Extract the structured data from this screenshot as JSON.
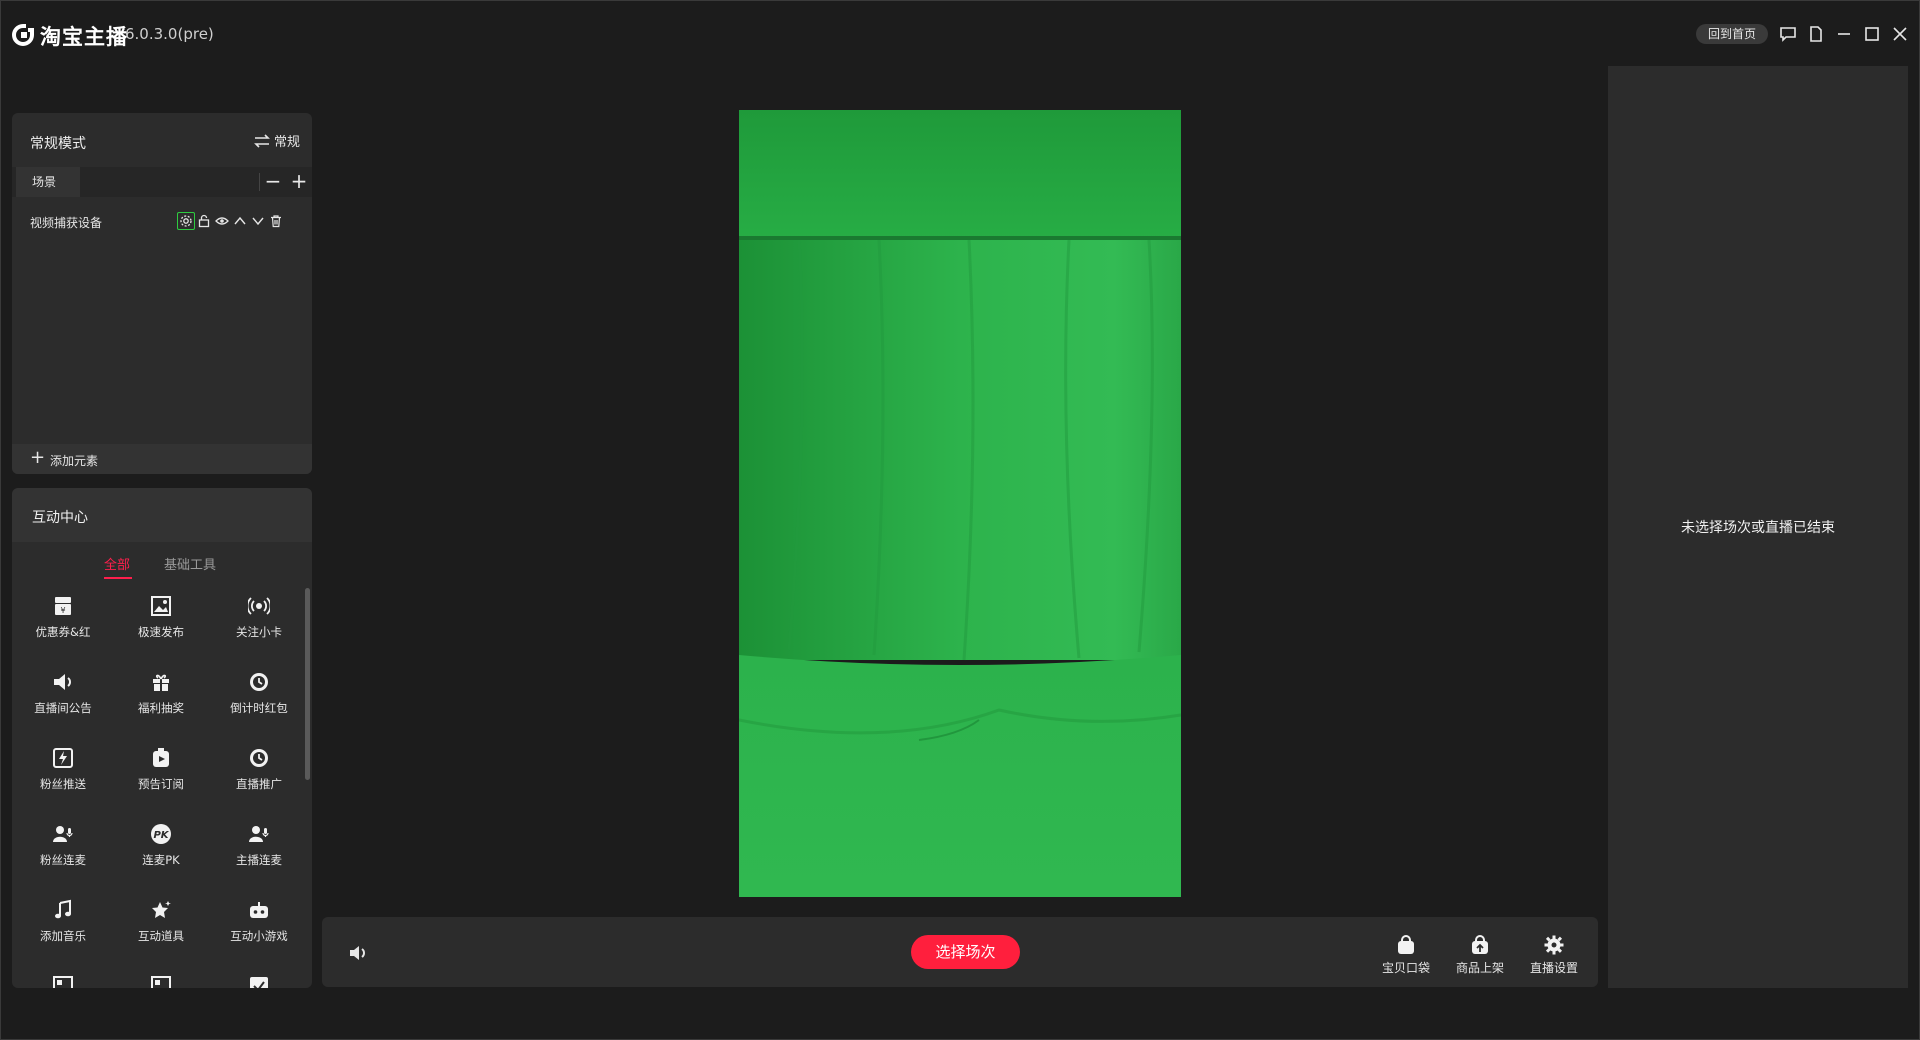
{
  "titlebar": {
    "app_name": "淘宝主播",
    "version": "6.0.3.0(pre)",
    "home_button": "回到首页"
  },
  "scene_panel": {
    "title": "常规模式",
    "mode_switch_label": "常规",
    "tab_label": "场景",
    "sources": [
      {
        "name": "视频捕获设备"
      }
    ],
    "add_element_label": "添加元素"
  },
  "interact_panel": {
    "title": "互动中心",
    "tabs": [
      {
        "label": "全部",
        "active": true
      },
      {
        "label": "基础工具",
        "active": false
      }
    ],
    "tools": [
      {
        "label": "优惠券&红",
        "icon": "coupon-icon"
      },
      {
        "label": "极速发布",
        "icon": "image-icon"
      },
      {
        "label": "关注小卡",
        "icon": "broadcast-icon"
      },
      {
        "label": "直播间公告",
        "icon": "speaker-icon"
      },
      {
        "label": "福利抽奖",
        "icon": "gift-icon"
      },
      {
        "label": "倒计时红包",
        "icon": "clock-icon"
      },
      {
        "label": "粉丝推送",
        "icon": "flash-icon"
      },
      {
        "label": "预告订阅",
        "icon": "alarm-icon"
      },
      {
        "label": "直播推广",
        "icon": "clock-icon"
      },
      {
        "label": "粉丝连麦",
        "icon": "user-mic-icon"
      },
      {
        "label": "连麦PK",
        "icon": "pk-icon"
      },
      {
        "label": "主播连麦",
        "icon": "user-mic-icon"
      },
      {
        "label": "添加音乐",
        "icon": "music-icon"
      },
      {
        "label": "互动道具",
        "icon": "star-icon"
      },
      {
        "label": "互动小游戏",
        "icon": "gamepad-icon"
      }
    ]
  },
  "control_bar": {
    "select_button": "选择场次",
    "tools": [
      {
        "label": "宝贝口袋",
        "icon": "bag-icon"
      },
      {
        "label": "商品上架",
        "icon": "upload-bag-icon"
      },
      {
        "label": "直播设置",
        "icon": "gear-icon"
      }
    ]
  },
  "right_panel": {
    "empty_message": "未选择场次或直播已结束"
  },
  "colors": {
    "accent": "#ff1f3d",
    "background": "#1c1c1c",
    "panel": "#2c2c2c",
    "selected_outline": "#2ecc40",
    "greenscreen": "#2fb04a"
  }
}
